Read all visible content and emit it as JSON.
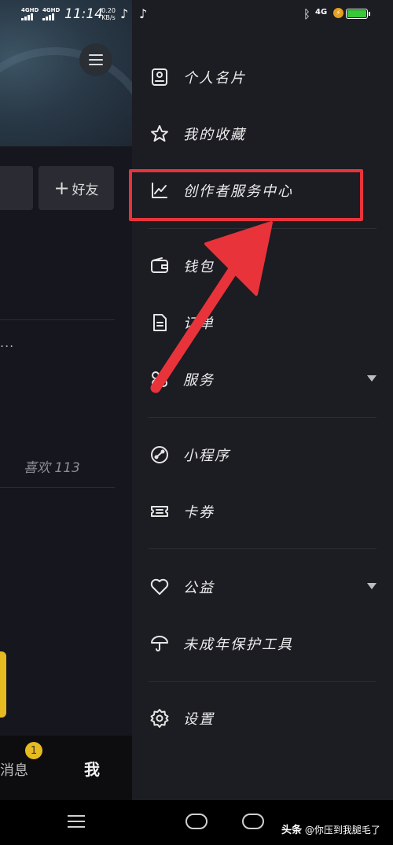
{
  "status_bar": {
    "sim1_label": "4GHD",
    "sim2_label": "4GHD",
    "time": "11:14",
    "net_speed_value": "0.20",
    "net_speed_unit": "KB/s",
    "right_network": "4G",
    "battery_level": 1.0,
    "battery_color": "#38c838"
  },
  "background": {
    "add_friend_label": "好友",
    "more_dots": "...",
    "likes_text": "喜欢 113",
    "tab_messages": "消息",
    "tab_me": "我",
    "messages_badge": "1"
  },
  "drawer": {
    "items": [
      {
        "label": "个人名片",
        "icon": "profile-card-icon"
      },
      {
        "label": "我的收藏",
        "icon": "star-icon"
      },
      {
        "label": "创作者服务中心",
        "icon": "line-chart-icon"
      },
      {
        "label": "钱包",
        "icon": "wallet-icon"
      },
      {
        "label": "订单",
        "icon": "document-icon"
      },
      {
        "label": "服务",
        "icon": "services-icon"
      },
      {
        "label": "小程序",
        "icon": "mini-program-icon"
      },
      {
        "label": "卡券",
        "icon": "ticket-icon"
      },
      {
        "label": "公益",
        "icon": "heart-icon"
      },
      {
        "label": "未成年保护工具",
        "icon": "umbrella-icon"
      },
      {
        "label": "设置",
        "icon": "gear-icon"
      }
    ]
  },
  "annotation": {
    "highlight_color": "#e8333a",
    "arrow_color": "#e8333a"
  },
  "watermark": {
    "brand": "头条",
    "handle": "@你压到我腿毛了"
  }
}
